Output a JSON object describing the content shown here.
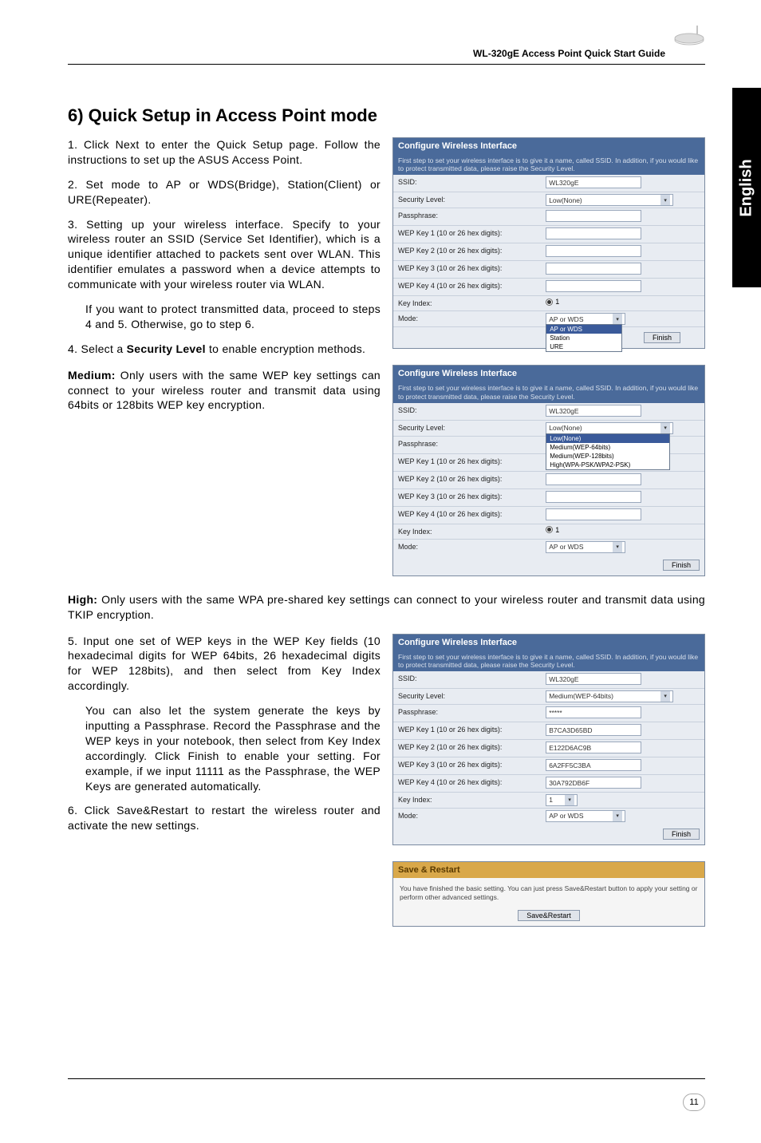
{
  "header": {
    "guide_title": "WL-320gE Access Point Quick Start Guide"
  },
  "side_tab": "English",
  "heading": "6) Quick Setup in Access Point mode",
  "steps": {
    "s1": "1. Click Next to enter the Quick Setup page. Follow the instructions to set up the ASUS Access Point.",
    "s2": "2. Set mode to AP or WDS(Bridge), Station(Client) or URE(Repeater).",
    "s3": "3. Setting up your wireless interface. Specify to your wireless router an SSID (Service Set Identifier), which is a unique identifier attached to packets sent over WLAN. This identifier emulates a password when a device attempts to communicate with your wireless router via WLAN.",
    "s3_sub": "If you want to protect transmitted data, proceed to steps 4 and 5. Otherwise, go to step 6.",
    "s4_pre": "4. Select a ",
    "s4_bold": "Security Level",
    "s4_post": " to enable encryption methods.",
    "s5": "5. Input one set of WEP keys in the WEP Key fields (10 hexadecimal digits for WEP 64bits, 26 hexadecimal digits for WEP 128bits), and then select from Key Index accordingly.",
    "s5_sub": "You can also let the system generate the keys by inputting a Passphrase. Record the Passphrase and the WEP keys in your notebook, then select from Key Index accordingly. Click Finish to enable your setting. For example, if we input 11111 as the Passphrase, the WEP Keys are generated automatically.",
    "s6": "6. Click Save&Restart to restart the wireless router and activate the new settings."
  },
  "para_medium_pre": "Medium:",
  "para_medium": " Only users with the same WEP key settings can connect to your wireless router and transmit data using 64bits or 128bits WEP key encryption.",
  "para_high_pre": "High:",
  "para_high": " Only users with the same WPA pre-shared key settings can connect to your wireless router and transmit data using TKIP encryption.",
  "panel1": {
    "title": "Configure Wireless Interface",
    "desc": "First step to set your wireless interface is to give it a name, called SSID. In addition, if you would like to protect transmitted data, please raise the Security Level.",
    "ssid_label": "SSID:",
    "ssid_value": "WL320gE",
    "sec_label": "Security Level:",
    "sec_value": "Low(None)",
    "pass_label": "Passphrase:",
    "k1": "WEP Key 1 (10 or 26 hex digits):",
    "k2": "WEP Key 2 (10 or 26 hex digits):",
    "k3": "WEP Key 3 (10 or 26 hex digits):",
    "k4": "WEP Key 4 (10 or 26 hex digits):",
    "keyindex": "Key Index:",
    "mode_label": "Mode:",
    "mode_value": "AP or WDS",
    "mode_opts": [
      "AP or WDS",
      "Station",
      "URE"
    ],
    "btn": "Finish"
  },
  "panel2": {
    "title": "Configure Wireless Interface",
    "desc": "First step to set your wireless interface is to give it a name, called SSID. In addition, if you would like to protect transmitted data, please raise the Security Level.",
    "ssid_label": "SSID:",
    "ssid_value": "WL320gE",
    "sec_label": "Security Level:",
    "sec_value": "Low(None)",
    "sec_opts": [
      "Low(None)",
      "Medium(WEP-64bits)",
      "Medium(WEP-128bits)",
      "High(WPA-PSK/WPA2-PSK)"
    ],
    "pass_label": "Passphrase:",
    "k1": "WEP Key 1 (10 or 26 hex digits):",
    "k2": "WEP Key 2 (10 or 26 hex digits):",
    "k3": "WEP Key 3 (10 or 26 hex digits):",
    "k4": "WEP Key 4 (10 or 26 hex digits):",
    "keyindex": "Key Index:",
    "mode_label": "Mode:",
    "mode_value": "AP or WDS",
    "btn": "Finish"
  },
  "panel3": {
    "title": "Configure Wireless Interface",
    "desc": "First step to set your wireless interface is to give it a name, called SSID. In addition, if you would like to protect transmitted data, please raise the Security Level.",
    "ssid_label": "SSID:",
    "ssid_value": "WL320gE",
    "sec_label": "Security Level:",
    "sec_value": "Medium(WEP-64bits)",
    "pass_label": "Passphrase:",
    "pass_value": "*****",
    "k1": "WEP Key 1 (10 or 26 hex digits):",
    "k1v": "B7CA3D65BD",
    "k2": "WEP Key 2 (10 or 26 hex digits):",
    "k2v": "E122D6AC9B",
    "k3": "WEP Key 3 (10 or 26 hex digits):",
    "k3v": "6A2FF5C3BA",
    "k4": "WEP Key 4 (10 or 26 hex digits):",
    "k4v": "30A792DB6F",
    "keyindex": "Key Index:",
    "keyindex_value": "1",
    "mode_label": "Mode:",
    "mode_value": "AP or WDS",
    "btn": "Finish"
  },
  "panel4": {
    "title": "Save & Restart",
    "desc": "You have finished the basic setting. You can just press Save&Restart button to apply your setting or perform other advanced settings.",
    "btn": "Save&Restart"
  },
  "page_number": "11"
}
